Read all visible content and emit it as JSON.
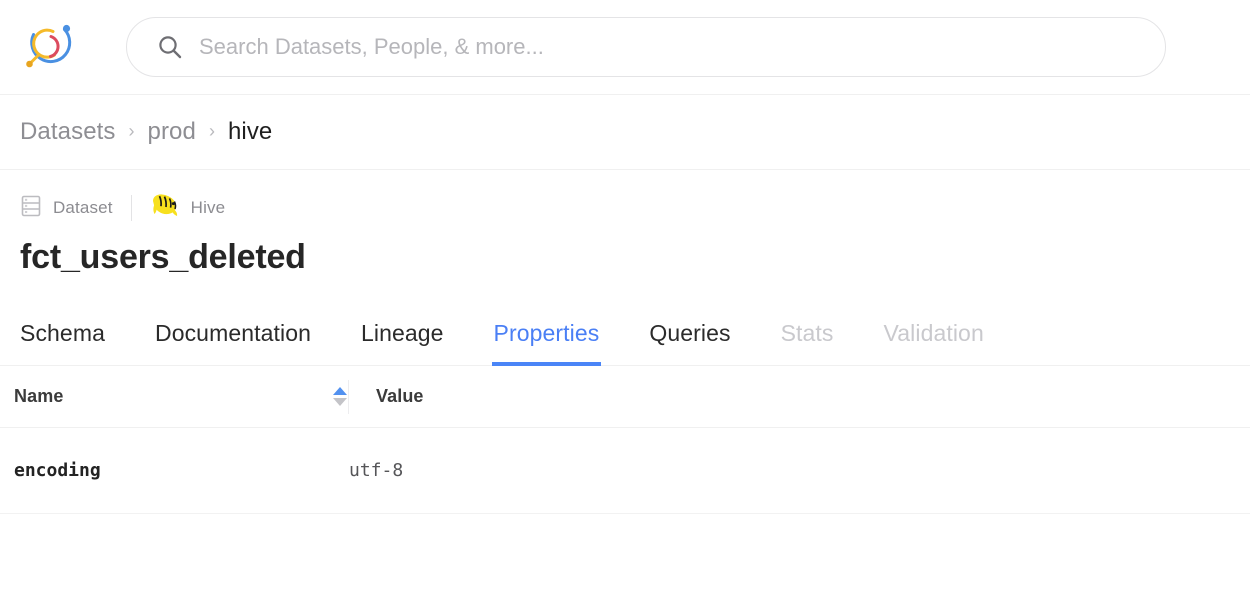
{
  "brand": {
    "logo_name": "datahub-logo",
    "colors": {
      "blue": "#4a90e2",
      "yellow": "#f5ba2a",
      "red": "#e24a5f",
      "accent": "#4a85f7"
    }
  },
  "search": {
    "placeholder": "Search Datasets, People, & more...",
    "value": "",
    "icon": "search-icon"
  },
  "breadcrumb": {
    "items": [
      {
        "label": "Datasets",
        "current": false
      },
      {
        "label": "prod",
        "current": false
      },
      {
        "label": "hive",
        "current": true
      }
    ],
    "separator": "›"
  },
  "entity": {
    "type_label": "Dataset",
    "type_icon": "dataset-icon",
    "platform_label": "Hive",
    "platform_icon": "hive-icon",
    "title": "fct_users_deleted"
  },
  "tabs": [
    {
      "label": "Schema",
      "state": "default"
    },
    {
      "label": "Documentation",
      "state": "default"
    },
    {
      "label": "Lineage",
      "state": "default"
    },
    {
      "label": "Properties",
      "state": "active"
    },
    {
      "label": "Queries",
      "state": "default"
    },
    {
      "label": "Stats",
      "state": "disabled"
    },
    {
      "label": "Validation",
      "state": "disabled"
    }
  ],
  "properties_table": {
    "columns": [
      {
        "label": "Name",
        "sortable": true,
        "sort_direction": "asc"
      },
      {
        "label": "Value",
        "sortable": false
      }
    ],
    "rows": [
      {
        "name": "encoding",
        "value": "utf-8"
      }
    ]
  }
}
